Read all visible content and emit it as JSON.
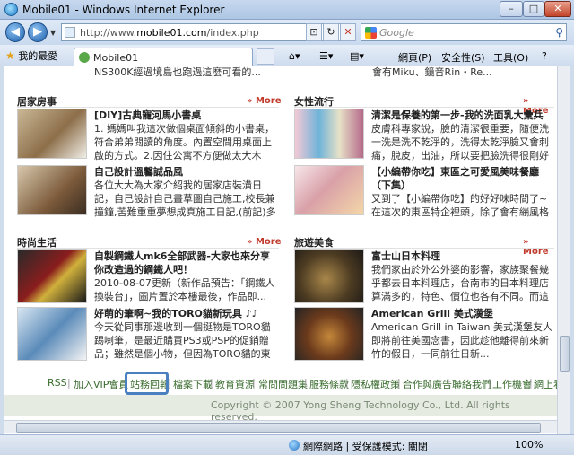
{
  "window": {
    "title": "Mobile01 - Windows Internet Explorer",
    "min": "–",
    "max": "□",
    "close": "✕"
  },
  "address": {
    "url_prefix": "http://www.",
    "url_domain": "mobile01.com",
    "url_suffix": "/index.php"
  },
  "search": {
    "placeholder": "Google",
    "icon": "search-icon"
  },
  "tabs": {
    "favorites_label": "我的最愛",
    "active_tab": "Mobile01"
  },
  "commands": {
    "page": "網頁(P)",
    "safety": "安全性(S)",
    "tools": "工具(O)",
    "help": "?"
  },
  "top_strip": {
    "left": "NS300K經過境島也跑過這麼可看的...",
    "right": "會有Miku、鏡音Rin・Re..."
  },
  "sections": [
    {
      "title": "居家房事",
      "more": "» More",
      "articles": [
        {
          "title": "[DIY]古典寵河馬小書桌",
          "text": "1. 媽媽叫我這次做個桌面傾斜的小書桌，符合弟弟閱讀的角度。內置空間用桌面上啟的方式。2.因住公寓不方便做太大木板，因此..."
        },
        {
          "title": "自己設計溫馨誠品風",
          "text": "各位大大為大家介紹我的居家店裝潢日記，自己設計自己畫草圖自己施工,校長兼撞鐘,苦難重重夢想成真施工日記,(前記)多年前..."
        }
      ]
    },
    {
      "title": "女性流行",
      "more": "» More",
      "articles": [
        {
          "title": "清潔是保養的第一步-我的洗面乳大彙兵",
          "text": "皮膚科專家說，臉的清潔很重要，隨便洗一洗是洗不乾淨的，洗得太乾淨臉又會刺痛，脫皮，出油，所以要把臉洗得很剛好~~每次因為微很..."
        },
        {
          "title": "【小編帶你吃】東區之可愛風美味餐廳（下集）",
          "text": "又到了【小編帶你吃】的好好味時間了~在這次的東區特企裡頭，除了會有繃風格的餐廳、大..."
        }
      ]
    },
    {
      "title": "時尚生活",
      "more": "» More",
      "articles": [
        {
          "title": "自製鋼鐵人mk6全部武器-大家也來分享你改造過的鋼鐵人吧！",
          "text": "2010-08-07更新（新作品預告：「鋼鐵人換裝台」，圖片置於本樓最後，作品即..."
        },
        {
          "title": "好萌的筆啊~我的TORO貓新玩具 ♪♪",
          "text": "今天從同事那邊收到一個挺物是TORO貓踢喇筆，是最近購買PS3或PSP的促銷贈品；雖然是個小物，但因為TORO貓的東西基..."
        }
      ]
    },
    {
      "title": "旅遊美食",
      "more": "» More",
      "articles": [
        {
          "title": "富士山日本料理",
          "text": "我們家由於外公外婆的影響，家族聚餐幾乎都去日本料理店，台南市的日本料理店算滿多的，特色、價位也各有不同。而這間富士山，則..."
        },
        {
          "title": "American Grill 美式漢堡",
          "text": "American Grill in Taiwan 美式漢堡友人即將前往美國念書，因此趁他離得前來新竹的假日，一同前往日新..."
        }
      ]
    }
  ],
  "footer_links": [
    "RSS",
    "加入VIP會員",
    "站務回報",
    "檔案下載",
    "教育資源",
    "常問問題集",
    "服務條款",
    "隱私權政策",
    "合作與廣告",
    "聯絡我們",
    "工作機會",
    "網上看"
  ],
  "copyright": "Copyright © 2007 Yong Sheng Technology Co., Ltd. All rights reserved.",
  "status": {
    "zone": "網際網路 | 受保護模式: 關閉",
    "zoom": "100%"
  }
}
